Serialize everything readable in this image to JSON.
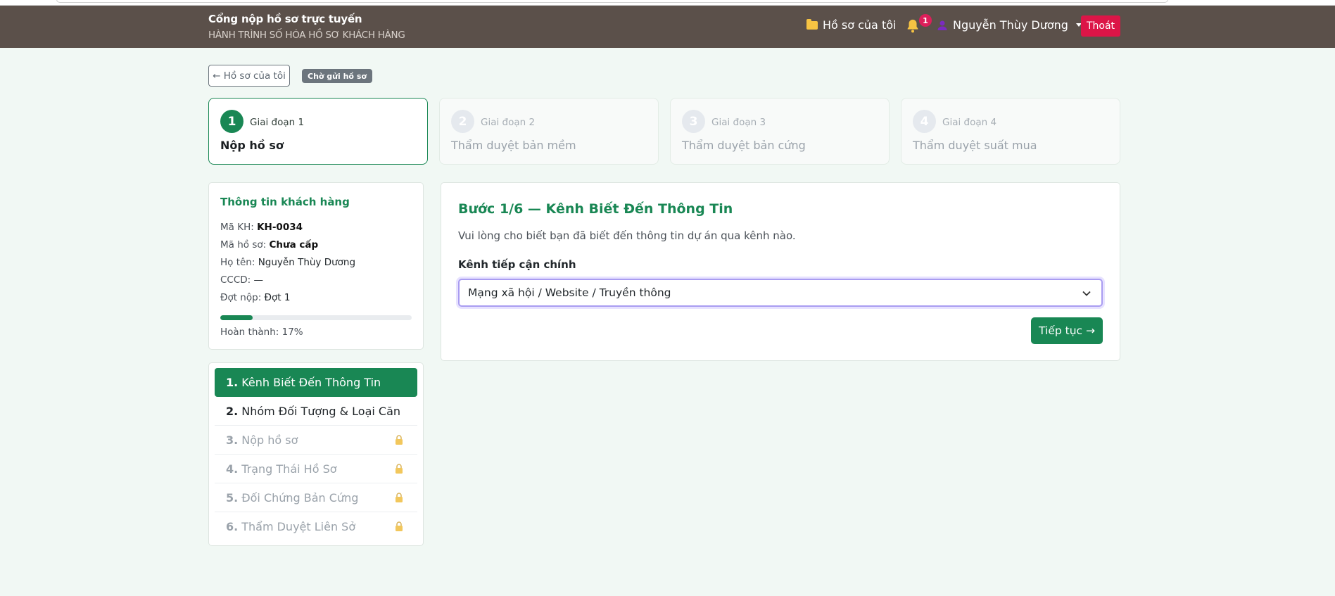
{
  "header": {
    "title": "Cổng nộp hồ sơ trực tuyến",
    "subtitle": "HÀNH TRÌNH SỐ HÓA HỒ SƠ KHÁCH HÀNG",
    "my_files_label": "Hồ sơ của tôi",
    "notification_count": "1",
    "user_name": "Nguyễn Thùy Dương",
    "logout_label": "Thoát"
  },
  "toolbar": {
    "back_label": "← Hồ sơ của tôi",
    "status_badge": "Chờ gửi hồ sơ"
  },
  "stages": [
    {
      "num": "1",
      "label": "Giai đoạn 1",
      "title": "Nộp hồ sơ"
    },
    {
      "num": "2",
      "label": "Giai đoạn 2",
      "title": "Thẩm duyệt bản mềm"
    },
    {
      "num": "3",
      "label": "Giai đoạn 3",
      "title": "Thẩm duyệt bản cứng"
    },
    {
      "num": "4",
      "label": "Giai đoạn 4",
      "title": "Thẩm duyệt suất mua"
    }
  ],
  "customer": {
    "title": "Thông tin khách hàng",
    "code_label": "Mã KH:",
    "code_value": "KH-0034",
    "file_label": "Mã hồ sơ:",
    "file_value": "Chưa cấp",
    "name_label": "Họ tên:",
    "name_value": "Nguyễn Thùy Dương",
    "id_label": "CCCD:",
    "id_value": "—",
    "round_label": "Đợt nộp:",
    "round_value": "Đợt 1",
    "progress": 0.17,
    "progress_text": "Hoàn thành: 17%"
  },
  "steps": [
    {
      "num": "1.",
      "label": "Kênh Biết Đến Thông Tin"
    },
    {
      "num": "2.",
      "label": "Nhóm Đối Tượng & Loại Căn"
    },
    {
      "num": "3.",
      "label": "Nộp hồ sơ"
    },
    {
      "num": "4.",
      "label": "Trạng Thái Hồ Sơ"
    },
    {
      "num": "5.",
      "label": "Đối Chứng Bản Cứng"
    },
    {
      "num": "6.",
      "label": "Thẩm Duyệt Liên Sở"
    }
  ],
  "form": {
    "heading": "Bước 1/6 — Kênh Biết Đến Thông Tin",
    "description": "Vui lòng cho biết bạn đã biết đến thông tin dự án qua kênh nào.",
    "field_label": "Kênh tiếp cận chính",
    "selected_option": "Mạng xã hội / Website / Truyền thông",
    "next_label": "Tiếp tục →"
  },
  "colors": {
    "primary": "#198754",
    "navbar": "#5b504a",
    "danger": "#dc1547"
  }
}
